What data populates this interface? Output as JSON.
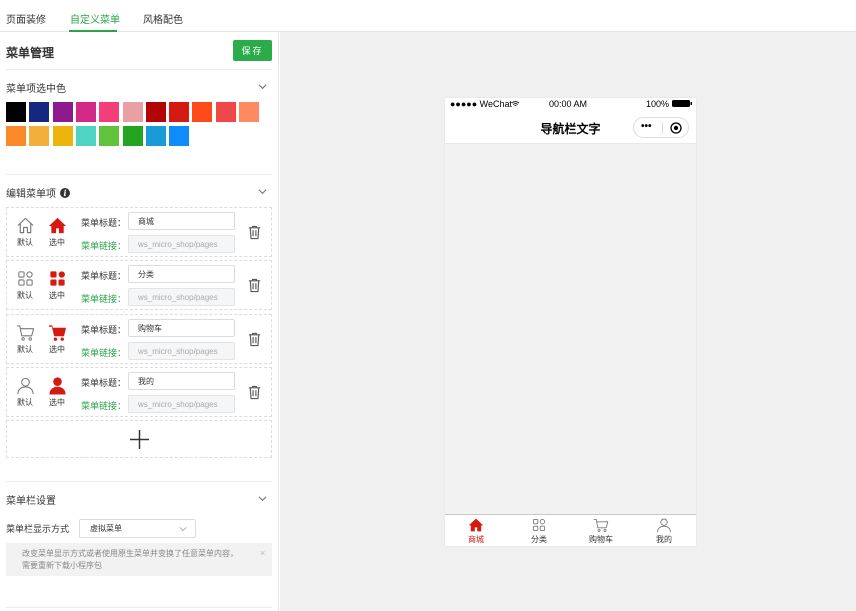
{
  "tabs": [
    {
      "label": "页面装修",
      "active": false
    },
    {
      "label": "自定义菜单",
      "active": true
    },
    {
      "label": "风格配色",
      "active": false
    }
  ],
  "panel": {
    "title": "菜单管理",
    "save_label": "保存"
  },
  "color_section": {
    "title": "菜单项选中色",
    "colors": [
      "#000000",
      "#15277f",
      "#8f1a8d",
      "#d42a87",
      "#f33e7a",
      "#e8a0a4",
      "#b20404",
      "#d51a11",
      "#ff4b1a",
      "#f04848",
      "#ff8a61",
      "#fa8a29",
      "#f0b03b",
      "#ebb50c",
      "#4fd3c3",
      "#61c33c",
      "#23a31f",
      "#1a9ad6",
      "#108cf8"
    ]
  },
  "edit_section": {
    "title": "编辑菜单项",
    "icon_default_label": "默认",
    "icon_selected_label": "选中",
    "title_label": "菜单标题：",
    "link_label": "菜单链接：",
    "items": [
      {
        "icon": "home",
        "title": "商城",
        "link": "ws_micro_shop/pages"
      },
      {
        "icon": "category",
        "title": "分类",
        "link": "ws_micro_shop/pages"
      },
      {
        "icon": "cart",
        "title": "购物车",
        "link": "ws_micro_shop/pages"
      },
      {
        "icon": "user",
        "title": "我的",
        "link": "ws_micro_shop/pages"
      }
    ]
  },
  "menubar_section": {
    "title": "菜单栏设置",
    "display_label": "菜单栏显示方式",
    "display_value": "虚拟菜单",
    "notice_line1": "改变菜单显示方式或者使用原生菜单并变换了任意菜单内容，",
    "notice_line2": "需要重新下载小程序包",
    "notice_close": "×"
  },
  "phone": {
    "signal": "●●●●● WeChat",
    "time": "00:00 AM",
    "battery": "100%",
    "nav_title": "导航栏文字",
    "capsule_dots": "•••"
  },
  "accent_color": "#d51a11",
  "brand_green": "#2bab4a"
}
